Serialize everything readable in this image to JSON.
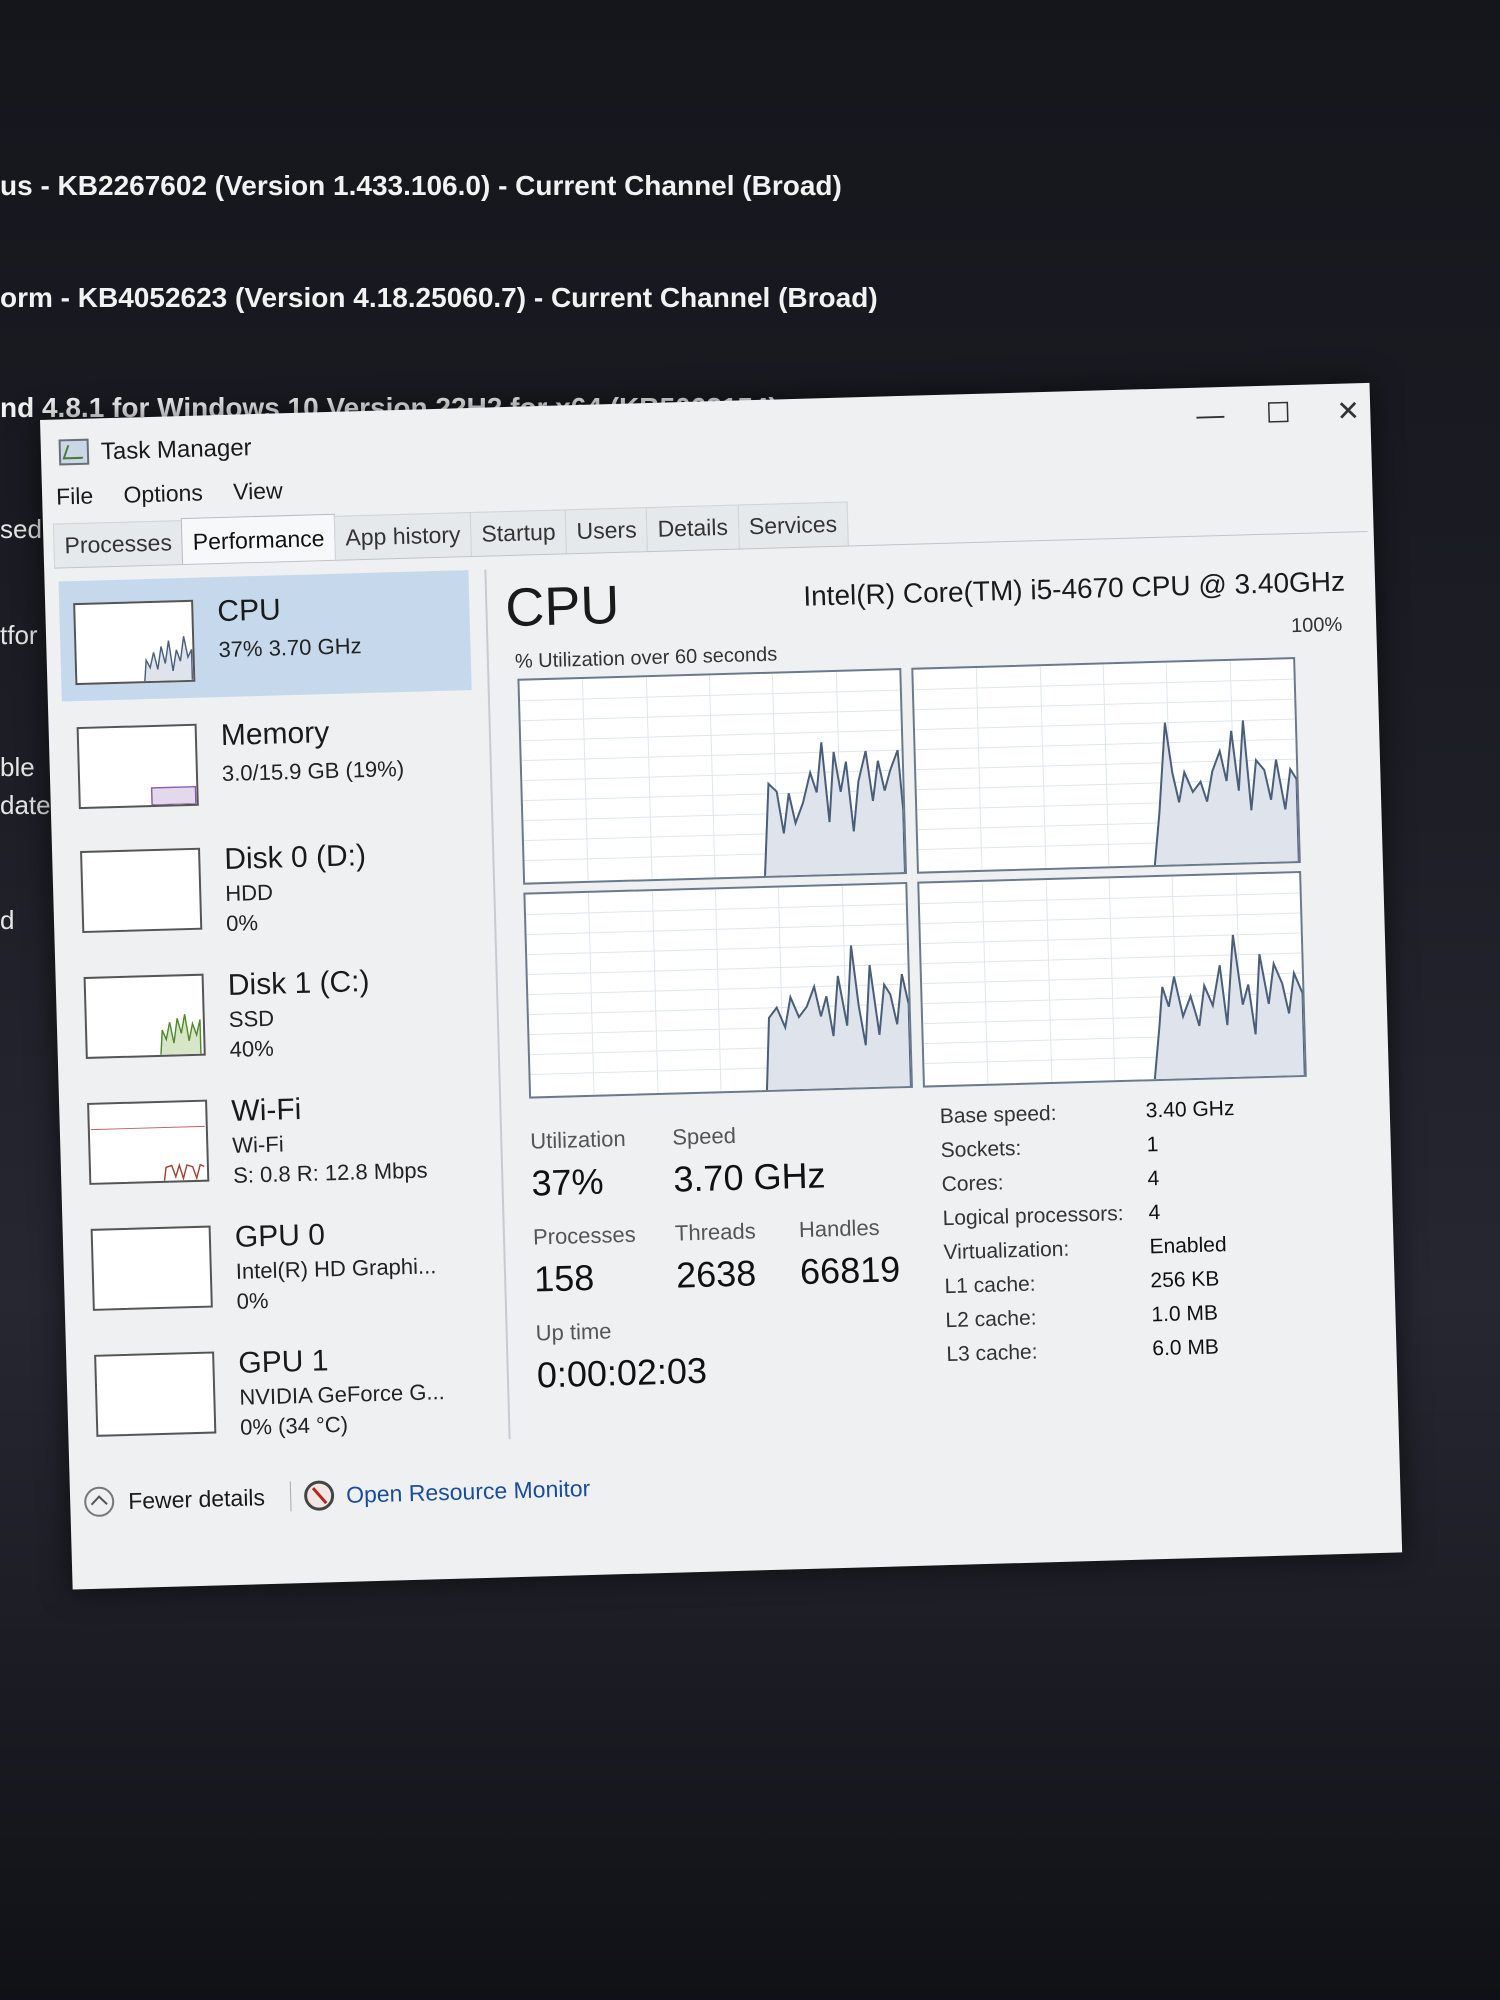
{
  "background": {
    "lines": [
      "us - KB2267602 (Version 1.433.106.0) - Current Channel (Broad)",
      "orm - KB4052623 (Version 4.18.25060.7) - Current Channel (Broad)",
      "nd 4.8.1 for Windows 10 Version 22H2 for x64 (KB5062154)"
    ],
    "fragments": [
      "sed",
      "tfor",
      "ble",
      "date",
      "d"
    ]
  },
  "window": {
    "title": "Task Manager",
    "buttons": {
      "minimize": "—",
      "maximize": "☐",
      "close": "✕"
    }
  },
  "menu": [
    "File",
    "Options",
    "View"
  ],
  "tabs": [
    "Processes",
    "Performance",
    "App history",
    "Startup",
    "Users",
    "Details",
    "Services"
  ],
  "active_tab": "Performance",
  "sidebar": [
    {
      "title": "CPU",
      "sub1": "37% 3.70 GHz",
      "sub2": "",
      "sub3": ""
    },
    {
      "title": "Memory",
      "sub1": "3.0/15.9 GB (19%)",
      "sub2": "",
      "sub3": ""
    },
    {
      "title": "Disk 0 (D:)",
      "sub1": "HDD",
      "sub2": "0%",
      "sub3": ""
    },
    {
      "title": "Disk 1 (C:)",
      "sub1": "SSD",
      "sub2": "40%",
      "sub3": ""
    },
    {
      "title": "Wi-Fi",
      "sub1": "Wi-Fi",
      "sub2": "S: 0.8 R: 12.8 Mbps",
      "sub3": ""
    },
    {
      "title": "GPU 0",
      "sub1": "Intel(R) HD Graphi...",
      "sub2": "0%",
      "sub3": ""
    },
    {
      "title": "GPU 1",
      "sub1": "NVIDIA GeForce G...",
      "sub2": "0% (34 °C)",
      "sub3": ""
    }
  ],
  "cpu": {
    "heading": "CPU",
    "model": "Intel(R) Core(TM) i5-4670 CPU @ 3.40GHz",
    "graph_label": "% Utilization over 60 seconds",
    "graph_max": "100%"
  },
  "stats": {
    "utilization_label": "Utilization",
    "utilization": "37%",
    "speed_label": "Speed",
    "speed": "3.70 GHz",
    "processes_label": "Processes",
    "processes": "158",
    "threads_label": "Threads",
    "threads": "2638",
    "handles_label": "Handles",
    "handles": "66819",
    "uptime_label": "Up time",
    "uptime": "0:00:02:03"
  },
  "specs": [
    {
      "label": "Base speed:",
      "value": "3.40 GHz"
    },
    {
      "label": "Sockets:",
      "value": "1"
    },
    {
      "label": "Cores:",
      "value": "4"
    },
    {
      "label": "Logical processors:",
      "value": "4"
    },
    {
      "label": "Virtualization:",
      "value": "Enabled"
    },
    {
      "label": "L1 cache:",
      "value": "256 KB"
    },
    {
      "label": "L2 cache:",
      "value": "1.0 MB"
    },
    {
      "label": "L3 cache:",
      "value": "6.0 MB"
    }
  ],
  "footer": {
    "fewer_details": "Fewer details",
    "resource_monitor": "Open Resource Monitor"
  },
  "colors": {
    "selected": "#c6d8ec",
    "graph_line": "#4a5e7a",
    "graph_fill": "#dfe3ec",
    "link": "#1a4c9c"
  }
}
